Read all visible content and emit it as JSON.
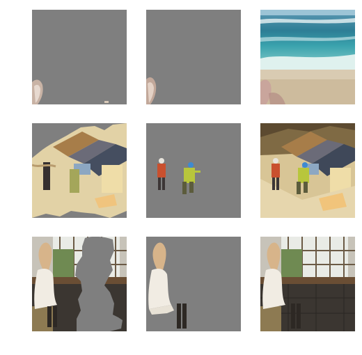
{
  "grid": {
    "rows": 3,
    "cols": 3,
    "background_gray": "#7f7f7f",
    "rows_content": [
      {
        "scene": "beach",
        "tiles": [
          {
            "kind": "masked-foreground",
            "icon": "partial-mask-icon"
          },
          {
            "kind": "masked-object",
            "icon": "object-mask-icon"
          },
          {
            "kind": "original-photo",
            "icon": "photo-icon"
          }
        ]
      },
      {
        "scene": "construction-workers",
        "tiles": [
          {
            "kind": "masked-background",
            "icon": "partial-mask-icon"
          },
          {
            "kind": "masked-object",
            "icon": "object-mask-icon"
          },
          {
            "kind": "original-photo",
            "icon": "photo-icon"
          }
        ]
      },
      {
        "scene": "woman-sitting-by-window",
        "tiles": [
          {
            "kind": "masked-person-removed",
            "icon": "partial-mask-icon"
          },
          {
            "kind": "masked-object",
            "icon": "object-mask-icon"
          },
          {
            "kind": "original-photo",
            "icon": "photo-icon"
          }
        ]
      }
    ]
  }
}
